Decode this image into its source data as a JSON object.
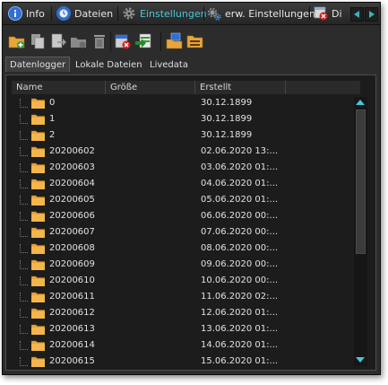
{
  "tabs": [
    {
      "label": "Info",
      "icon": "info-icon",
      "active": false
    },
    {
      "label": "Dateien",
      "icon": "clock-icon",
      "active": false
    },
    {
      "label": "Einstellungen",
      "icon": "gear-icon",
      "active": true
    },
    {
      "label": "erw. Einstellungen",
      "icon": "gears-icon",
      "active": false
    },
    {
      "label": "Di",
      "icon": "delete-window-icon",
      "active": false
    }
  ],
  "toolbar": {
    "buttons": [
      "new-folder-icon",
      "copy-icon",
      "move-icon",
      "folder-action-icon",
      "delete-icon",
      "format-card-icon",
      "export-icon",
      "card-to-folder-icon",
      "folder-settings-icon"
    ]
  },
  "subtabs": [
    {
      "label": "Datenlogger",
      "active": true
    },
    {
      "label": "Lokale Dateien",
      "active": false
    },
    {
      "label": "Livedata",
      "active": false
    }
  ],
  "columns": {
    "name": "Name",
    "size": "Größe",
    "created": "Erstellt"
  },
  "rows": [
    {
      "name": "0",
      "size": "",
      "created": "30.12.1899"
    },
    {
      "name": "1",
      "size": "",
      "created": "30.12.1899"
    },
    {
      "name": "2",
      "size": "",
      "created": "30.12.1899"
    },
    {
      "name": "20200602",
      "size": "",
      "created": "02.06.2020 13:..."
    },
    {
      "name": "20200603",
      "size": "",
      "created": "03.06.2020 01:..."
    },
    {
      "name": "20200604",
      "size": "",
      "created": "04.06.2020 01:..."
    },
    {
      "name": "20200605",
      "size": "",
      "created": "05.06.2020 01:..."
    },
    {
      "name": "20200606",
      "size": "",
      "created": "06.06.2020 00:..."
    },
    {
      "name": "20200607",
      "size": "",
      "created": "07.06.2020 00:..."
    },
    {
      "name": "20200608",
      "size": "",
      "created": "08.06.2020 00:..."
    },
    {
      "name": "20200609",
      "size": "",
      "created": "09.06.2020 00:..."
    },
    {
      "name": "20200610",
      "size": "",
      "created": "10.06.2020 00:..."
    },
    {
      "name": "20200611",
      "size": "",
      "created": "11.06.2020 02:..."
    },
    {
      "name": "20200612",
      "size": "",
      "created": "12.06.2020 01:..."
    },
    {
      "name": "20200613",
      "size": "",
      "created": "13.06.2020 01:..."
    },
    {
      "name": "20200614",
      "size": "",
      "created": "14.06.2020 01:..."
    },
    {
      "name": "20200615",
      "size": "",
      "created": "15.06.2020 01:..."
    }
  ],
  "colors": {
    "accent": "#46c8d8",
    "background": "#1c1c1c",
    "folder": "#e8a53a"
  }
}
